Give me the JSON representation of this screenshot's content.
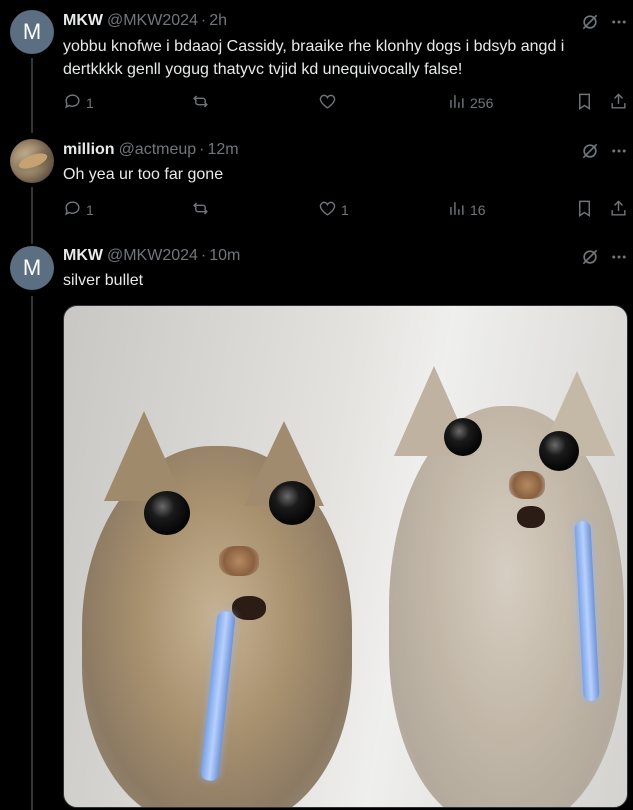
{
  "tweets": [
    {
      "avatar_letter": "M",
      "name": "MKW",
      "handle": "@MKW2024",
      "time": "2h",
      "text": "yobbu knofwe i bdaaoj Cassidy, braaike rhe klonhy dogs  i bdsyb angd i dertkkkk genll yogug thatyvc tvjid kd unequivocally false!",
      "replies": "1",
      "reposts": "",
      "likes": "",
      "views": "256"
    },
    {
      "name": "million",
      "handle": "@actmeup",
      "time": "12m",
      "text": "Oh yea ur too far gone",
      "replies": "1",
      "reposts": "",
      "likes": "1",
      "views": "16"
    },
    {
      "avatar_letter": "M",
      "name": "MKW",
      "handle": "@MKW2024",
      "time": "10m",
      "text": "silver bullet"
    }
  ],
  "separator": "·",
  "colors": {
    "background": "#000000",
    "text": "#e7e9ea",
    "secondary": "#71767b",
    "avatar_m": "#5b6e82",
    "thread_line": "#333639"
  },
  "icons": {
    "reply": "reply-icon",
    "repost": "repost-icon",
    "like": "heart-icon",
    "views": "views-icon",
    "bookmark": "bookmark-icon",
    "share": "share-icon",
    "grok": "grok-icon",
    "more": "more-icon"
  }
}
